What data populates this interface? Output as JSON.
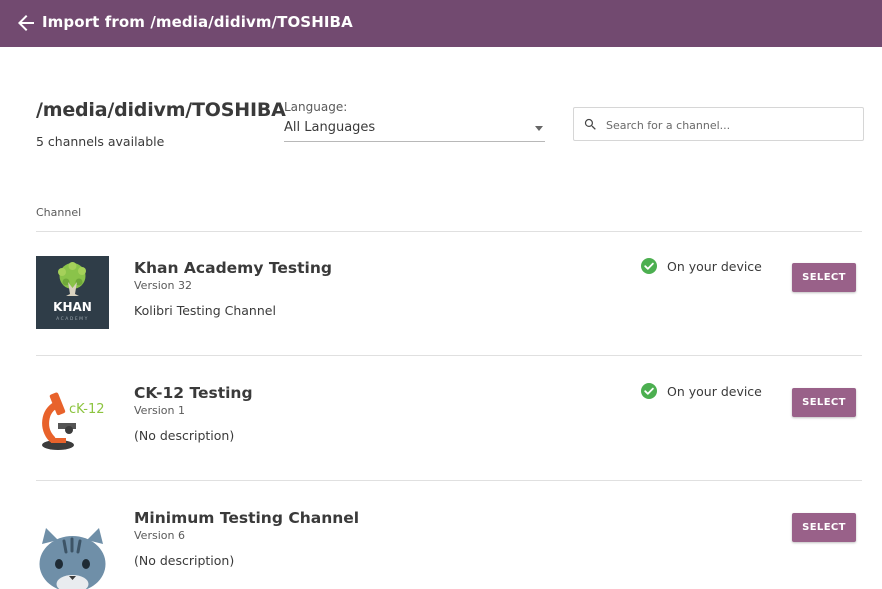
{
  "appbar": {
    "title": "Import from /media/didivm/TOSHIBA",
    "back_icon": "arrow-left-icon"
  },
  "header": {
    "title": "/media/didivm/TOSHIBA",
    "count": "5 channels available"
  },
  "filters": {
    "language_label": "Language:",
    "language_value": "All Languages",
    "search_placeholder": "Search for a channel..."
  },
  "table": {
    "column_header": "Channel"
  },
  "channels": [
    {
      "name": "Khan Academy Testing",
      "version": "Version 32",
      "description": "Kolibri Testing Channel",
      "status": "On your device",
      "action": "SELECT",
      "thumb": "khan-academy-logo",
      "logo_text": "KHAN",
      "logo_subtext": "ACADEMY"
    },
    {
      "name": "CK-12 Testing",
      "version": "Version 1",
      "description": "(No description)",
      "status": "On your device",
      "action": "SELECT",
      "thumb": "ck12-logo",
      "logo_text": "cK-12"
    },
    {
      "name": "Minimum Testing Channel",
      "version": "Version 6",
      "description": "(No description)",
      "status": "",
      "action": "SELECT",
      "thumb": "cat-logo"
    }
  ],
  "colors": {
    "appbar": "#724a70",
    "button": "#996189",
    "status_check": "#4caf50"
  }
}
